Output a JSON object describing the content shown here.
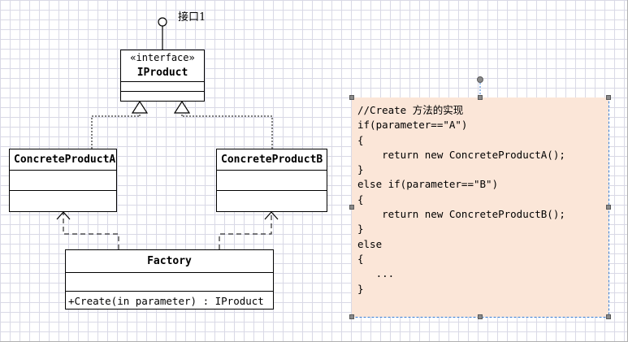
{
  "interface_label": "接口1",
  "iproduct": {
    "stereotype": "«interface»",
    "name": "IProduct"
  },
  "concrete_a": {
    "name": "ConcreteProductA"
  },
  "concrete_b": {
    "name": "ConcreteProductB"
  },
  "factory": {
    "name": "Factory",
    "operation": "+Create(in parameter) : IProduct"
  },
  "note": {
    "lines": [
      "//Create 方法的实现",
      "if(parameter==\"A\")",
      "{",
      "    return new ConcreteProductA();",
      "}",
      "else if(parameter==\"B\")",
      "{",
      "    return new ConcreteProductB();",
      "}",
      "else",
      "{",
      "   ...",
      "}"
    ]
  },
  "colors": {
    "note_fill": "#fbe6d8",
    "grid": "#d9d9e6",
    "selection": "#3a7fd5"
  }
}
